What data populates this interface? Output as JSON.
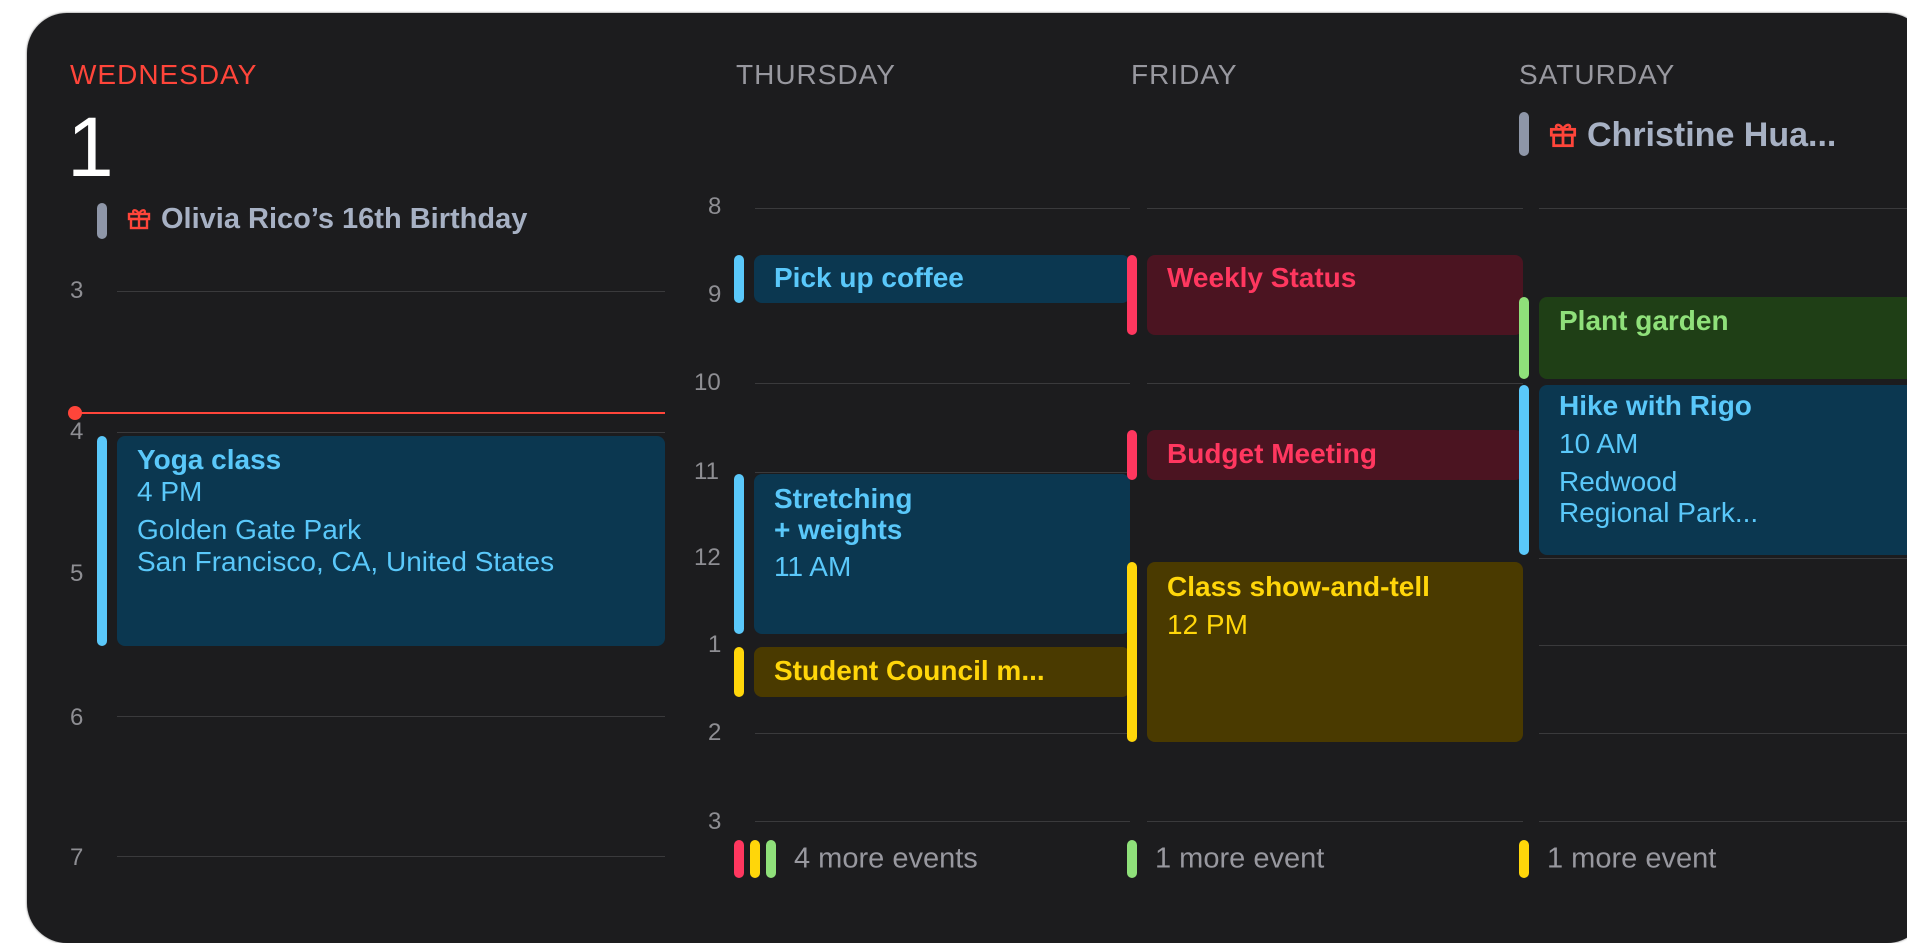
{
  "colors": {
    "background": "#1c1c1e",
    "today": "#ff453a",
    "blue": "#5ac8fa",
    "red": "#ff375f",
    "green": "#8fe07a",
    "yellow": "#ffd60a",
    "birthday_gray": "#a7b1c4"
  },
  "days": {
    "wednesday": {
      "name": "WEDNESDAY",
      "date": "1",
      "allday": "Olivia Rico’s 16th Birthday",
      "hours": [
        "3",
        "4",
        "5",
        "6",
        "7"
      ],
      "events": {
        "yoga": {
          "title": "Yoga class",
          "time": "4 PM",
          "location": "Golden Gate Park\nSan Francisco, CA, United States"
        }
      }
    },
    "thursday": {
      "name": "THURSDAY",
      "hours": [
        "8",
        "9",
        "10",
        "11",
        "12",
        "1",
        "2",
        "3"
      ],
      "events": {
        "coffee": {
          "title": "Pick up coffee"
        },
        "stretching": {
          "title": "Stretching\n+ weights",
          "time": "11 AM"
        },
        "council": {
          "title": "Student Council m..."
        }
      },
      "more": "4 more events"
    },
    "friday": {
      "name": "FRIDAY",
      "events": {
        "weekly": {
          "title": "Weekly Status"
        },
        "budget": {
          "title": "Budget Meeting"
        },
        "showtell": {
          "title": "Class show-and-tell",
          "time": "12 PM"
        }
      },
      "more": "1 more event"
    },
    "saturday": {
      "name": "SATURDAY",
      "allday": "Christine Hua...",
      "events": {
        "garden": {
          "title": "Plant garden"
        },
        "hike": {
          "title": "Hike with Rigo",
          "time": "10 AM",
          "location": "Redwood\nRegional Park..."
        }
      },
      "more": "1 more event"
    }
  },
  "icons": {
    "gift": "gift-icon"
  }
}
